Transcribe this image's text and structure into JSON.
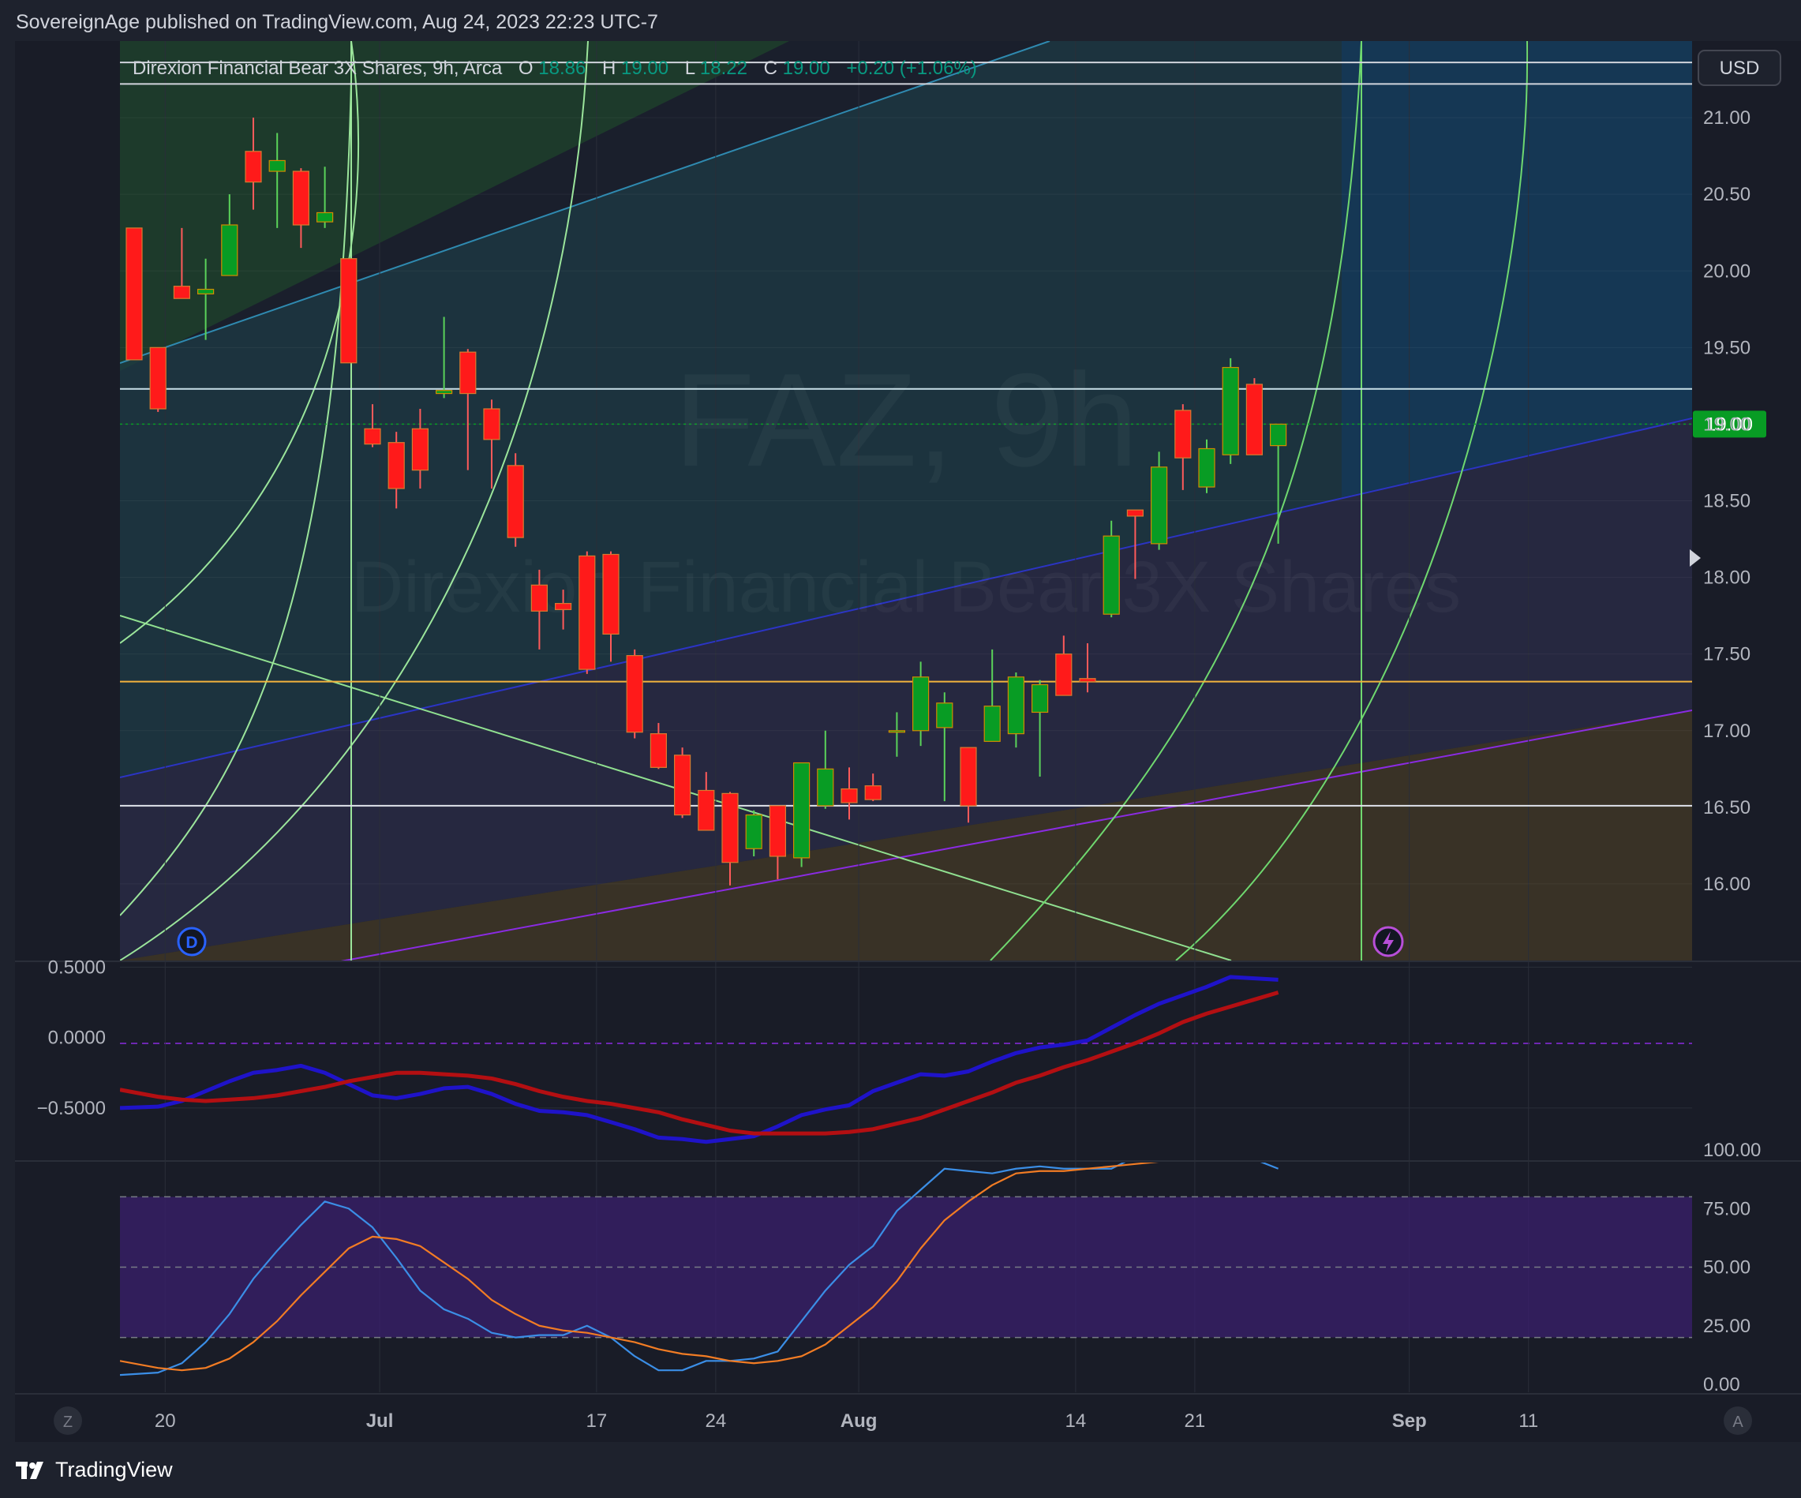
{
  "header": {
    "published_by": "SovereignAge published on TradingView.com, Aug 24, 2023 22:23 UTC-7"
  },
  "footer": {
    "brand": "TradingView"
  },
  "legend": {
    "name": "Direxion Financial Bear 3X Shares, 9h, Arca",
    "o_label": "O",
    "o_value": "18.86",
    "h_label": "H",
    "h_value": "19.00",
    "l_label": "L",
    "l_value": "18.22",
    "c_label": "C",
    "c_value": "19.00",
    "change": "+0.20 (+1.06%)"
  },
  "watermark": {
    "symbol": "FAZ, 9h",
    "name": "Direxion Financial Bear 3X Shares"
  },
  "currency": "USD",
  "last_price": "19.00",
  "markers": {
    "dividend": "D"
  },
  "scale_buttons": {
    "left": "Z",
    "right": "A"
  },
  "colors": {
    "up": "#089c24",
    "down": "#ff1a1a",
    "macd": "#1f13c9",
    "signal": "#b30f12",
    "k_line": "#3b8ee6",
    "d_line": "#f27c24",
    "band": "#3a1f6e",
    "price_label": "#089c24"
  },
  "chart_data": [
    {
      "type": "candlestick",
      "title": "Direxion Financial Bear 3X Shares, 9h, Arca",
      "ylim": [
        15.5,
        21.5
      ],
      "yticks": [
        "21.00",
        "20.50",
        "20.00",
        "19.50",
        "19.00",
        "18.50",
        "18.00",
        "17.50",
        "17.00",
        "16.50",
        "16.00"
      ],
      "xticks": [
        {
          "label": "20",
          "bar": 1.3
        },
        {
          "label": "Jul",
          "bar": 10.3
        },
        {
          "label": "17",
          "bar": 19.4
        },
        {
          "label": "24",
          "bar": 24.4
        },
        {
          "label": "Aug",
          "bar": 30.4
        },
        {
          "label": "14",
          "bar": 39.5
        },
        {
          "label": "21",
          "bar": 44.5
        },
        {
          "label": "Sep",
          "bar": 53.5
        },
        {
          "label": "11",
          "bar": 58.5
        }
      ],
      "horizontal_levels": [
        21.36,
        21.22,
        19.23,
        17.32,
        16.51
      ],
      "candles": [
        {
          "o": 20.28,
          "h": 20.28,
          "l": 19.42,
          "c": 19.42
        },
        {
          "o": 19.5,
          "h": 19.5,
          "l": 19.08,
          "c": 19.1
        },
        {
          "o": 19.9,
          "h": 20.28,
          "l": 19.82,
          "c": 19.82
        },
        {
          "o": 19.85,
          "h": 20.08,
          "l": 19.55,
          "c": 19.88
        },
        {
          "o": 19.97,
          "h": 20.5,
          "l": 19.97,
          "c": 20.3
        },
        {
          "o": 20.78,
          "h": 21.0,
          "l": 20.4,
          "c": 20.58
        },
        {
          "o": 20.65,
          "h": 20.9,
          "l": 20.28,
          "c": 20.72
        },
        {
          "o": 20.65,
          "h": 20.67,
          "l": 20.15,
          "c": 20.3
        },
        {
          "o": 20.32,
          "h": 20.68,
          "l": 20.28,
          "c": 20.38
        },
        {
          "o": 20.08,
          "h": 20.08,
          "l": 19.4,
          "c": 19.4
        },
        {
          "o": 18.97,
          "h": 19.13,
          "l": 18.85,
          "c": 18.87
        },
        {
          "o": 18.88,
          "h": 18.95,
          "l": 18.45,
          "c": 18.58
        },
        {
          "o": 18.97,
          "h": 19.1,
          "l": 18.58,
          "c": 18.7
        },
        {
          "o": 19.2,
          "h": 19.7,
          "l": 19.17,
          "c": 19.22
        },
        {
          "o": 19.47,
          "h": 19.49,
          "l": 18.7,
          "c": 19.2
        },
        {
          "o": 19.1,
          "h": 19.16,
          "l": 18.58,
          "c": 18.9
        },
        {
          "o": 18.73,
          "h": 18.81,
          "l": 18.2,
          "c": 18.26
        },
        {
          "o": 17.95,
          "h": 18.05,
          "l": 17.53,
          "c": 17.78
        },
        {
          "o": 17.83,
          "h": 17.92,
          "l": 17.66,
          "c": 17.79
        },
        {
          "o": 18.14,
          "h": 18.17,
          "l": 17.37,
          "c": 17.4
        },
        {
          "o": 18.15,
          "h": 18.17,
          "l": 17.45,
          "c": 17.63
        },
        {
          "o": 17.49,
          "h": 17.53,
          "l": 16.95,
          "c": 16.99
        },
        {
          "o": 16.98,
          "h": 17.05,
          "l": 16.75,
          "c": 16.76
        },
        {
          "o": 16.84,
          "h": 16.89,
          "l": 16.43,
          "c": 16.45
        },
        {
          "o": 16.61,
          "h": 16.73,
          "l": 16.35,
          "c": 16.35
        },
        {
          "o": 16.59,
          "h": 16.6,
          "l": 15.99,
          "c": 16.14
        },
        {
          "o": 16.23,
          "h": 16.48,
          "l": 16.18,
          "c": 16.45
        },
        {
          "o": 16.51,
          "h": 16.51,
          "l": 16.03,
          "c": 16.18
        },
        {
          "o": 16.17,
          "h": 16.63,
          "l": 16.11,
          "c": 16.79
        },
        {
          "o": 16.51,
          "h": 17.0,
          "l": 16.49,
          "c": 16.75
        },
        {
          "o": 16.62,
          "h": 16.76,
          "l": 16.42,
          "c": 16.53
        },
        {
          "o": 16.64,
          "h": 16.72,
          "l": 16.54,
          "c": 16.55
        },
        {
          "o": 17.0,
          "h": 17.12,
          "l": 16.83,
          "c": 17.0
        },
        {
          "o": 17.0,
          "h": 17.45,
          "l": 16.9,
          "c": 17.35
        },
        {
          "o": 17.02,
          "h": 17.25,
          "l": 16.54,
          "c": 17.18
        },
        {
          "o": 16.89,
          "h": 16.89,
          "l": 16.4,
          "c": 16.51
        },
        {
          "o": 16.93,
          "h": 17.53,
          "l": 16.93,
          "c": 17.16
        },
        {
          "o": 16.98,
          "h": 17.38,
          "l": 16.89,
          "c": 17.35
        },
        {
          "o": 17.12,
          "h": 17.33,
          "l": 16.7,
          "c": 17.3
        },
        {
          "o": 17.5,
          "h": 17.62,
          "l": 17.26,
          "c": 17.23
        },
        {
          "o": 17.34,
          "h": 17.57,
          "l": 17.25,
          "c": 17.32
        },
        {
          "o": 17.76,
          "h": 18.37,
          "l": 17.74,
          "c": 18.27
        },
        {
          "o": 18.44,
          "h": 18.44,
          "l": 17.99,
          "c": 18.4
        },
        {
          "o": 18.22,
          "h": 18.82,
          "l": 18.18,
          "c": 18.72
        },
        {
          "o": 19.09,
          "h": 19.13,
          "l": 18.57,
          "c": 18.78
        },
        {
          "o": 18.59,
          "h": 18.9,
          "l": 18.55,
          "c": 18.84
        },
        {
          "o": 18.8,
          "h": 19.43,
          "l": 18.74,
          "c": 19.37
        },
        {
          "o": 19.26,
          "h": 19.3,
          "l": 18.8,
          "c": 18.8
        },
        {
          "o": 18.86,
          "h": 19.0,
          "l": 18.22,
          "c": 19.0
        }
      ]
    },
    {
      "type": "line",
      "ylim": [
        -0.87,
        0.53
      ],
      "yticks": [
        "0.5000",
        "0.0000",
        "−0.5000"
      ],
      "series": [
        {
          "key": "macd",
          "values": [
            -0.5,
            -0.49,
            -0.45,
            -0.38,
            -0.31,
            -0.25,
            -0.23,
            -0.2,
            -0.25,
            -0.33,
            -0.41,
            -0.43,
            -0.4,
            -0.36,
            -0.35,
            -0.4,
            -0.47,
            -0.52,
            -0.53,
            -0.55,
            -0.6,
            -0.65,
            -0.71,
            -0.72,
            -0.74,
            -0.72,
            -0.7,
            -0.63,
            -0.55,
            -0.51,
            -0.48,
            -0.38,
            -0.32,
            -0.26,
            -0.27,
            -0.24,
            -0.17,
            -0.11,
            -0.07,
            -0.05,
            -0.02,
            0.07,
            0.16,
            0.24,
            0.3,
            0.36,
            0.43,
            0.42,
            0.41
          ]
        },
        {
          "key": "signal",
          "values": [
            -0.37,
            -0.42,
            -0.44,
            -0.45,
            -0.44,
            -0.43,
            -0.41,
            -0.38,
            -0.35,
            -0.31,
            -0.28,
            -0.25,
            -0.25,
            -0.26,
            -0.27,
            -0.29,
            -0.33,
            -0.38,
            -0.42,
            -0.45,
            -0.47,
            -0.5,
            -0.53,
            -0.58,
            -0.62,
            -0.66,
            -0.68,
            -0.68,
            -0.68,
            -0.68,
            -0.67,
            -0.65,
            -0.61,
            -0.57,
            -0.51,
            -0.45,
            -0.39,
            -0.32,
            -0.27,
            -0.21,
            -0.16,
            -0.1,
            -0.04,
            0.03,
            0.11,
            0.17,
            0.22,
            0.27,
            0.32
          ]
        }
      ]
    },
    {
      "type": "line",
      "ylim": [
        0,
        100
      ],
      "yticks": [
        "100.00",
        "75.00",
        "50.00",
        "25.00",
        "0.00"
      ],
      "band": [
        20,
        80
      ],
      "series": [
        {
          "key": "k_line",
          "values": [
            4,
            5,
            9,
            18,
            30,
            45,
            57,
            68,
            78,
            75,
            67,
            54,
            40,
            32,
            28,
            22,
            20,
            21,
            21,
            25,
            20,
            12,
            6,
            6,
            10,
            10,
            11,
            14,
            27,
            40,
            51,
            59,
            74,
            83,
            92,
            91,
            90,
            92,
            93,
            92,
            92,
            92,
            97,
            98,
            98,
            98,
            98,
            96,
            92
          ]
        },
        {
          "key": "d_line",
          "values": [
            10,
            7,
            6,
            7,
            11,
            18,
            27,
            38,
            48,
            58,
            63,
            62,
            59,
            52,
            45,
            36,
            30,
            25,
            23,
            22,
            20,
            18,
            15,
            13,
            12,
            10,
            9,
            10,
            12,
            17,
            25,
            33,
            44,
            58,
            70,
            78,
            85,
            90,
            91,
            91,
            92,
            93,
            94,
            95,
            96,
            97,
            97,
            98,
            98
          ]
        }
      ]
    }
  ]
}
